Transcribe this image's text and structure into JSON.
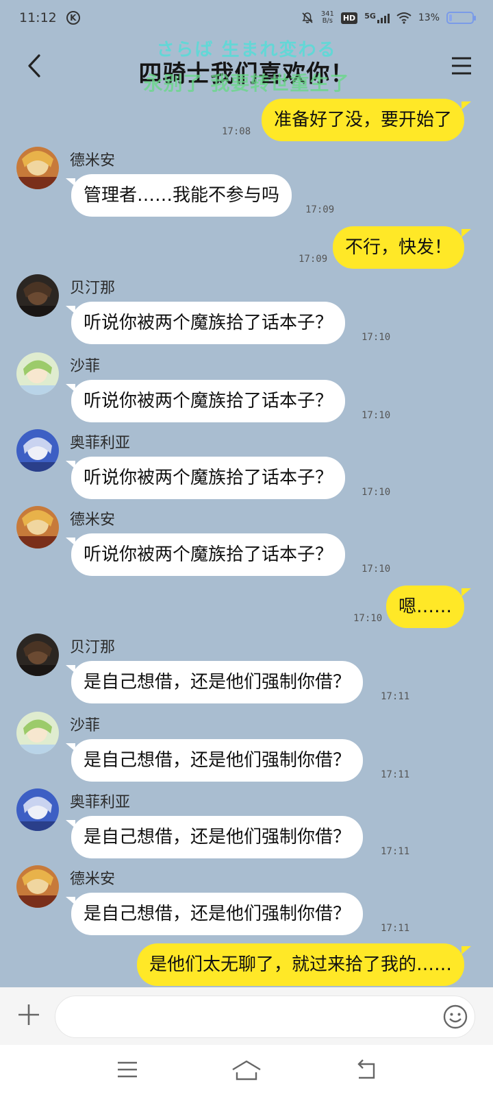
{
  "status": {
    "time": "11:12",
    "carrier_badge": "K",
    "speed_top": "341",
    "speed_bottom": "B/s",
    "hd": "HD",
    "network": "5G",
    "battery": "13%",
    "battery_level": 0.13,
    "icons": [
      "bell-off-icon",
      "hd-icon",
      "signal-icon",
      "wifi-icon",
      "battery-icon"
    ]
  },
  "header": {
    "title": "四骑士我们喜欢你！",
    "overlay_top": "さらば 生まれ変わる",
    "overlay_bottom": "永别了 我要转世重生了",
    "back_icon": "chevron-left-icon",
    "menu_icon": "menu-icon"
  },
  "messages": [
    {
      "side": "out",
      "text": "准备好了没，要开始了",
      "time": "17:08"
    },
    {
      "side": "in",
      "sender": "德米安",
      "text": "管理者……我能不参与吗",
      "time": "17:09"
    },
    {
      "side": "out",
      "text": "不行，快发！",
      "time": "17:09"
    },
    {
      "side": "in",
      "sender": "贝汀那",
      "text": "听说你被两个魔族拾了话本子？",
      "time": "17:10"
    },
    {
      "side": "in",
      "sender": "沙菲",
      "text": "听说你被两个魔族拾了话本子？",
      "time": "17:10"
    },
    {
      "side": "in",
      "sender": "奥菲利亚",
      "text": "听说你被两个魔族拾了话本子？",
      "time": "17:10"
    },
    {
      "side": "in",
      "sender": "德米安",
      "text": "听说你被两个魔族拾了话本子？",
      "time": "17:10"
    },
    {
      "side": "out",
      "text": "嗯……",
      "time": "17:10"
    },
    {
      "side": "in",
      "sender": "贝汀那",
      "text": "是自己想借，还是他们强制你借？",
      "time": "17:11"
    },
    {
      "side": "in",
      "sender": "沙菲",
      "text": "是自己想借，还是他们强制你借？",
      "time": "17:11"
    },
    {
      "side": "in",
      "sender": "奥菲利亚",
      "text": "是自己想借，还是他们强制你借？",
      "time": "17:11"
    },
    {
      "side": "in",
      "sender": "德米安",
      "text": "是自己想借，还是他们强制你借？",
      "time": "17:11"
    },
    {
      "side": "out",
      "text": "是他们太无聊了，就过来拾了我的……"
    }
  ],
  "input": {
    "placeholder": "",
    "plus_icon": "plus-icon",
    "emoji_icon": "emoji-icon"
  },
  "nav": {
    "icons": [
      "recent-apps-icon",
      "home-icon",
      "back-icon"
    ]
  },
  "colors": {
    "background": "#a9bdd0",
    "outgoing_bubble": "#ffe827",
    "incoming_bubble": "#ffffff"
  }
}
